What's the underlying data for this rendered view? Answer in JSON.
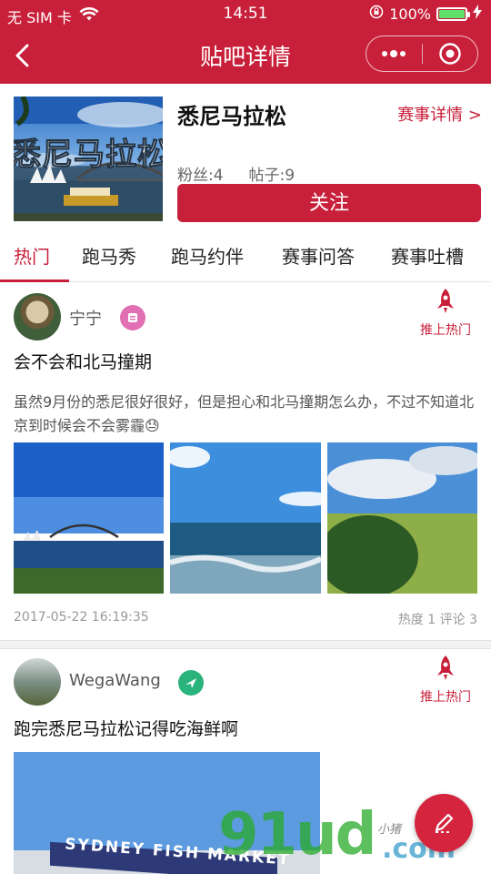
{
  "status_bar": {
    "carrier": "无 SIM 卡",
    "time": "14:51",
    "battery": "100%",
    "battery_level": 1.0
  },
  "nav": {
    "title": "贴吧详情"
  },
  "bar": {
    "cover_text": "悉尼马拉松",
    "name": "悉尼马拉松",
    "event_link": "赛事详情 >",
    "fans_label": "粉丝:4",
    "posts_label": "帖子:9",
    "follow_button": "关注"
  },
  "tabs": [
    {
      "label": "热门",
      "active": true
    },
    {
      "label": "跑马秀",
      "active": false
    },
    {
      "label": "跑马约伴",
      "active": false
    },
    {
      "label": "赛事问答",
      "active": false
    },
    {
      "label": "赛事吐槽",
      "active": false
    }
  ],
  "posts": [
    {
      "username": "宁宁",
      "boost_label": "推上热门",
      "title": "会不会和北马撞期",
      "body": "虽然9月份的悉尼很好很好，但是担心和北马撞期怎么办，不过不知道北京到时候会不会雾霾😓",
      "timestamp": "2017-05-22 16:19:35",
      "stats": "热度 1 评论 3"
    },
    {
      "username": "WegaWang",
      "boost_label": "推上热门",
      "title": "跑完悉尼马拉松记得吃海鲜啊",
      "image_sign": "SYDNEY FISH MARKET"
    }
  ],
  "watermark": {
    "main": "91ud",
    "suffix": ".com",
    "handwriting": "小猪"
  },
  "colors": {
    "brand": "#c8203a",
    "badge_pink": "#e16fb4",
    "badge_green": "#2ab37a"
  }
}
